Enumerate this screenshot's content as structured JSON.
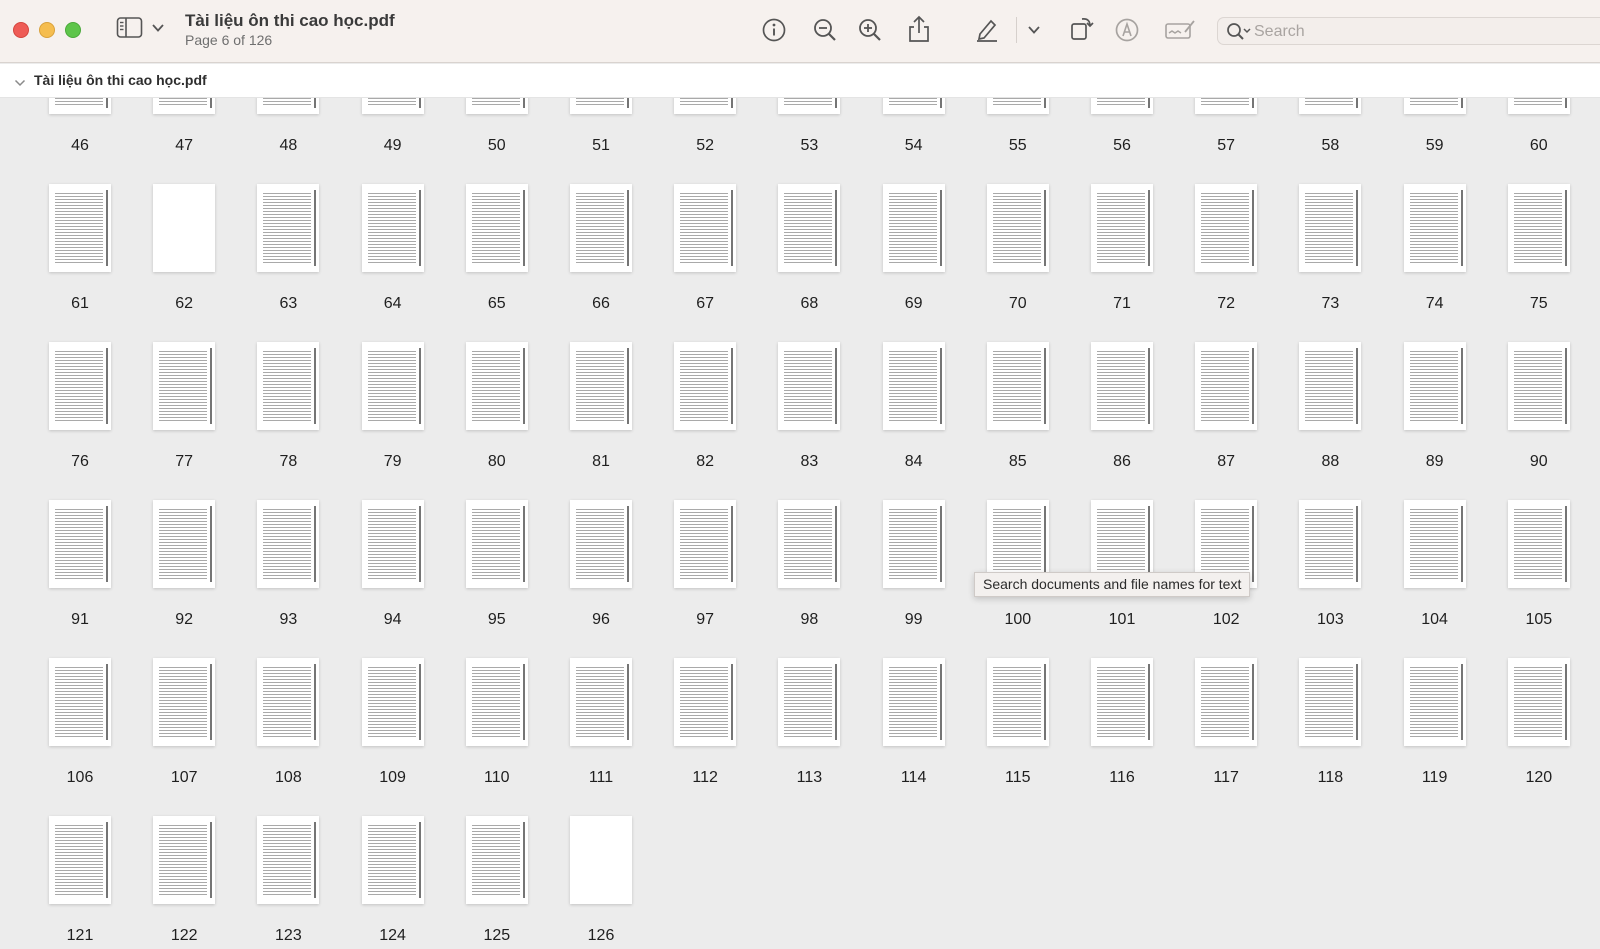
{
  "window": {
    "title": "Tài liệu ôn thi cao học.pdf",
    "subtitle": "Page 6 of 126"
  },
  "toolbar": {
    "icons": [
      "sidebar-toggle-icon",
      "chevron-down-icon",
      "info-icon",
      "zoom-out-icon",
      "zoom-in-icon",
      "share-icon",
      "highlight-pen-icon",
      "chevron-down-icon",
      "rotate-icon",
      "markup-icon",
      "signature-icon"
    ],
    "search_placeholder": "Search"
  },
  "sidebar": {
    "document_name": "Tài liệu ôn thi cao học.pdf"
  },
  "pages": {
    "first_visible": 46,
    "last": 126,
    "blank_pages": [
      62,
      126
    ]
  },
  "tooltip": {
    "text": "Search documents and file names for text"
  }
}
